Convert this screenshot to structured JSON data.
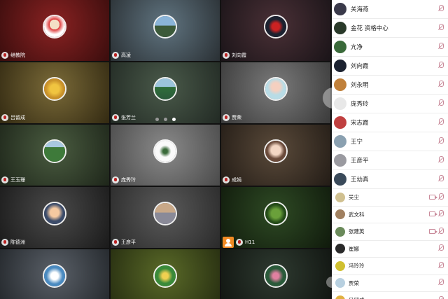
{
  "tiles": [
    {
      "name": "继教院",
      "bg": "radial-gradient(circle at 50% 40%, #8a2222, #3a0d0d)",
      "avatar": "radial-gradient(circle at 50% 40%, #f4e0c6 30%, #d33 31%, #fff 60%)"
    },
    {
      "name": "高凌",
      "bg": "radial-gradient(circle at 50% 40%, #607480, #2a3034)",
      "avatar": "linear-gradient(#8ab4d8 45%, #3c5a3a 46%)"
    },
    {
      "name": "刘向霞",
      "bg": "radial-gradient(circle at 50% 40%, #4a3036, #1a1418)",
      "avatar": "radial-gradient(circle at 50% 50%, #c22 25%, #1c2230 50%)"
    },
    {
      "name": "吕留成",
      "bg": "radial-gradient(circle at 50% 40%, #7a6a38, #332a12)",
      "avatar": "radial-gradient(circle at 50% 50%, #f0c440 30%, #c8902a 60%)"
    },
    {
      "name": "张芳兰",
      "bg": "radial-gradient(circle at 50% 40%, #4a5a4a, #222a24)",
      "avatar": "linear-gradient(#9cc4dc 40%, #2f6e3a 41%, #2a5a3a)"
    },
    {
      "name": "贾荣",
      "bg": "radial-gradient(circle at 50% 40%, #7a7a7a, #3a3a3a)",
      "avatar": "radial-gradient(circle at 50% 40%, #f5d0c0 25%, #b8dce6 50%)"
    },
    {
      "name": "王玉珊",
      "bg": "radial-gradient(circle at 50% 40%, #4a5c40, #1e261a)",
      "avatar": "linear-gradient(#a8c8e0 30%, #3e7a3a 31%)"
    },
    {
      "name": "庞秀玲",
      "bg": "radial-gradient(circle at 50% 40%, #8a8a8a, #4a4a4a)",
      "avatar": "radial-gradient(circle at 50% 50%, #3a6a3a 15%, #fafafa 40%)"
    },
    {
      "name": "成娟",
      "bg": "radial-gradient(circle at 50% 40%, #5a4a3a, #231c16)",
      "avatar": "radial-gradient(circle at 50% 45%, #f3d6c4 30%, #6a4a3a 55%)"
    },
    {
      "name": "陈德洲",
      "bg": "radial-gradient(circle at 50% 40%, #4a4a4a, #1a1a1a)",
      "avatar": "radial-gradient(circle at 50% 45%, #f5c9a0 28%, #3c4c6a 55%)"
    },
    {
      "name": "王彦平",
      "bg": "radial-gradient(circle at 50% 40%, #5a5a5a, #2a2a2a)",
      "avatar": "linear-gradient(#c8a888 45%, #8a8a98 46%)"
    },
    {
      "name": "H11",
      "bg": "radial-gradient(circle at 50% 40%, #2e4a24, #101a0c)",
      "avatar": "radial-gradient(circle at 50% 50%, #6aa03a 30%, #244a18 60%)",
      "host": true
    },
    {
      "name": "",
      "bg": "radial-gradient(circle at 50% 40%, #5a6068, #22262a)",
      "avatar": "radial-gradient(circle at 50% 50%, #fff 25%, #4a8ac0 55%)"
    },
    {
      "name": "",
      "bg": "radial-gradient(circle at 50% 40%, #5a6a28, #252c10)",
      "avatar": "radial-gradient(circle at 50% 50%, #f0d050 20%, #3a8a3a 50%)"
    },
    {
      "name": "",
      "bg": "radial-gradient(circle at 50% 40%, #2e3a30, #101410)",
      "avatar": "radial-gradient(circle at 50% 50%, #e080a0 20%, #2a5a3a 50%)"
    }
  ],
  "pager": {
    "count": 3,
    "active": 2
  },
  "participants": [
    {
      "name": "关海燕",
      "color": "#3a3a4a",
      "cam": false,
      "small": false
    },
    {
      "name": "金花 资格中心",
      "color": "#2a3a2a",
      "cam": false,
      "small": false
    },
    {
      "name": "亢净",
      "color": "#3a6a3a",
      "cam": false,
      "small": false
    },
    {
      "name": "刘向霞",
      "color": "#1c2230",
      "cam": false,
      "small": false
    },
    {
      "name": "刘永明",
      "color": "#c0803a",
      "cam": false,
      "small": false
    },
    {
      "name": "庞秀玲",
      "color": "#e8e8e8",
      "cam": false,
      "small": false
    },
    {
      "name": "宋志霞",
      "color": "#c04040",
      "cam": false,
      "small": false
    },
    {
      "name": "王宁",
      "color": "#8aa0b0",
      "cam": false,
      "small": false
    },
    {
      "name": "王彦平",
      "color": "#9a9aa0",
      "cam": false,
      "small": false
    },
    {
      "name": "王幼真",
      "color": "#3a4a5a",
      "cam": false,
      "small": false
    },
    {
      "name": "吴尘",
      "color": "#d0c090",
      "cam": true,
      "small": true
    },
    {
      "name": "武文科",
      "color": "#a08060",
      "cam": true,
      "small": true
    },
    {
      "name": "张建英",
      "color": "#6a8a5a",
      "cam": true,
      "small": true
    },
    {
      "name": "崔娜",
      "color": "#2a2a2a",
      "cam": false,
      "small": true
    },
    {
      "name": "冯玲玲",
      "color": "#d0c030",
      "cam": false,
      "small": true
    },
    {
      "name": "贾荣",
      "color": "#b8d0e0",
      "cam": false,
      "small": true
    },
    {
      "name": "吕留成",
      "color": "#e0b040",
      "cam": false,
      "small": true
    }
  ]
}
